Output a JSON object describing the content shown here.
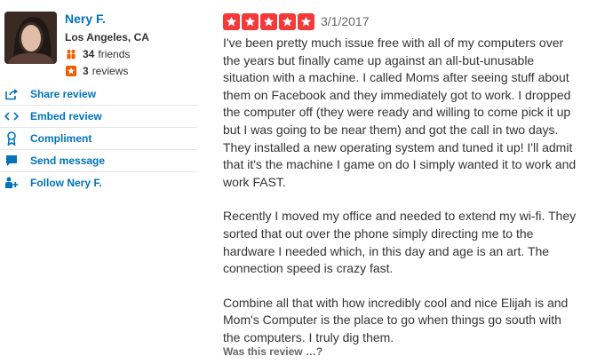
{
  "user": {
    "name": "Nery F.",
    "location": "Los Angeles, CA",
    "friends_count": "34",
    "friends_label": "friends",
    "reviews_count": "3",
    "reviews_label": "reviews"
  },
  "actions": [
    {
      "label": "Share review",
      "icon": "share-icon"
    },
    {
      "label": "Embed review",
      "icon": "embed-icon"
    },
    {
      "label": "Compliment",
      "icon": "compliment-icon"
    },
    {
      "label": "Send message",
      "icon": "message-icon"
    },
    {
      "label": "Follow Nery F.",
      "icon": "follow-icon"
    }
  ],
  "review": {
    "rating": 5,
    "date": "3/1/2017",
    "paragraphs": [
      "I've been pretty much issue free with all of my computers over the years but finally came up against an all-but-unusable situation with a machine. I called Moms after seeing stuff about them on Facebook and they immediately got to work. I dropped the computer off (they were ready and willing to come pick it up but I was going to be near them) and got the call in two days. They installed a new operating system and tuned it up! I'll admit that it's the machine I game on do I simply wanted it to work and work FAST.",
      "Recently I moved my office and needed to extend my wi-fi. They sorted that out over the phone simply directing me to the hardware I needed which, in this day and age is an art. The connection speed is crazy fast.",
      "Combine all that with how incredibly cool and nice Elijah is and Mom's Computer is the place to go when things go south with the computers. I truly dig them."
    ],
    "helpful_prompt": "Was this review …?"
  },
  "colors": {
    "star_red": "#f43939",
    "link_blue": "#0073bb",
    "friends_orange": "#f15c00",
    "reviews_badge": "#f15c00"
  }
}
